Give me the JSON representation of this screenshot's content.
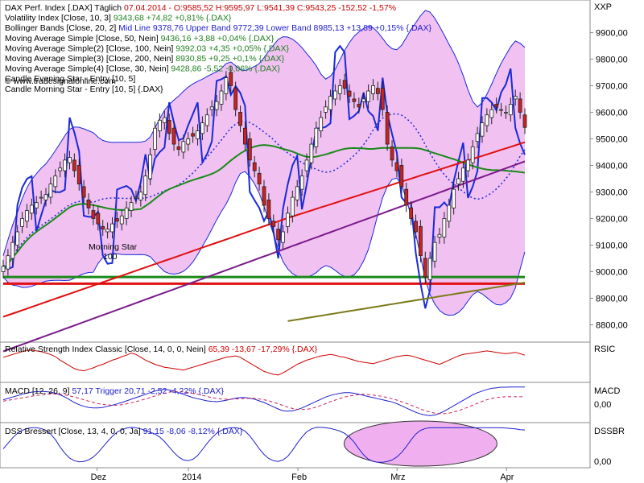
{
  "colors": {
    "candle_up": "#ffffff",
    "candle_down": "#cc2222",
    "bollinger_fill": "#eeb6ee",
    "bollinger_band": "#1a2ad8",
    "sma50": "#1a8a1a",
    "sma100": "#e01010",
    "sma200": "#7a1a8a",
    "sma30": "#7a7a1a",
    "rsi": "#cc0000",
    "macd": "#2020cc",
    "macd_trigger": "#cc2255",
    "dss": "#2020cc",
    "highlight": "#f0b0f0"
  },
  "chart_data": [
    {
      "type": "candlestick",
      "panel": "price",
      "title": "DAX Perf. Index [.DAX] Täglich",
      "legend": [
        {
          "label": "DAX Perf. Index [.DAX] Täglich",
          "values": "07.04.2014 - O:9585,52 H:9595,97 L:9541,39 C:9543,25 -152,52 -1,57%"
        },
        {
          "label": "Volatility Index [Close, 10, 3]",
          "values": "9343,68 +74,82 +0,81% {.DAX}"
        },
        {
          "label": "Bollinger Bands [Close, 20, 2]",
          "values": "Mid Line 9378,76 Upper Band 9772,39 Lower Band 8985,13 +13,89 +0,15% {.DAX}"
        },
        {
          "label": "Moving Average Simple [Close, 50, Nein]",
          "values": "9436,16 +3,88 +0,04% {.DAX}"
        },
        {
          "label": "Moving Average Simple(2) [Close, 100, Nein]",
          "values": "9392,03 +4,35 +0,05% {.DAX}"
        },
        {
          "label": "Moving Average Simple(3) [Close, 200, Nein]",
          "values": "8930,85 +9,25 +0,1% {.DAX}"
        },
        {
          "label": "Moving Average Simple(4) [Close, 30, Nein]",
          "values": "9428,86 -5,52 -0,06% {.DAX}"
        },
        {
          "label": "Candle Evening Star - Entry [10, 5]",
          "values": ""
        },
        {
          "label": "Candle Morning Star - Entry [10, 5] {.DAX}",
          "values": ""
        }
      ],
      "watermark": "© www.tradesignalonline.com",
      "annotations": [
        "Morning Star",
        "100"
      ],
      "y_ticks": [
        "8800,00",
        "8900,00",
        "9000,00",
        "9100,00",
        "9200,00",
        "9300,00",
        "9400,00",
        "9500,00",
        "9600,00",
        "9700,00",
        "9800,00",
        "9900,00"
      ],
      "y_axis_label": "XXP",
      "ylim": [
        8750,
        9980
      ],
      "horizontal_lines": [
        {
          "value": 8980,
          "color": "#1a8a1a"
        },
        {
          "value": 8955,
          "color": "#e01010"
        }
      ],
      "closes": [
        9020,
        9060,
        9110,
        9150,
        9200,
        9230,
        9250,
        9260,
        9280,
        9290,
        9330,
        9360,
        9390,
        9420,
        9430,
        9380,
        9330,
        9280,
        9240,
        9200,
        9180,
        9160,
        9160,
        9180,
        9190,
        9210,
        9240,
        9260,
        9280,
        9300,
        9360,
        9440,
        9540,
        9570,
        9580,
        9520,
        9480,
        9460,
        9490,
        9500,
        9510,
        9530,
        9560,
        9590,
        9620,
        9640,
        9680,
        9730,
        9700,
        9610,
        9550,
        9480,
        9420,
        9380,
        9330,
        9250,
        9200,
        9170,
        9120,
        9150,
        9220,
        9280,
        9320,
        9360,
        9420,
        9480,
        9540,
        9580,
        9620,
        9660,
        9680,
        9700,
        9690,
        9660,
        9640,
        9620,
        9650,
        9680,
        9700,
        9670,
        9610,
        9480,
        9420,
        9380,
        9320,
        9250,
        9200,
        9150,
        9060,
        8980,
        9050,
        9110,
        9140,
        9200,
        9250,
        9310,
        9350,
        9390,
        9420,
        9470,
        9520,
        9560,
        9590,
        9610,
        9620,
        9610,
        9600,
        9630,
        9660,
        9600,
        9543
      ],
      "macd_lines": {
        "ylim": [
          -65,
          65
        ],
        "y_ticks": [
          "0,00"
        ],
        "label": "MACD"
      },
      "rsi_label": "RSIC",
      "dss_label": "DSSBR",
      "x_labels": [
        "Dez",
        "2014",
        "Feb",
        "Mrz",
        "Apr"
      ]
    },
    {
      "type": "line",
      "panel": "rsi",
      "title": "Relative Strength Index Classic [Close, 14, 0, 0, Nein]",
      "values_text": "65,39 -13,67 -17,29% {.DAX}",
      "y_label": "RSIC",
      "series": [
        {
          "values": [
            62,
            64,
            66,
            68,
            70,
            72,
            72,
            71,
            70,
            68,
            66,
            63,
            58,
            54,
            50,
            46,
            44,
            43,
            45,
            47,
            50,
            52,
            55,
            58,
            60,
            63,
            65,
            68,
            66,
            62,
            58,
            55,
            52,
            50,
            48,
            47,
            46,
            45,
            44,
            46,
            48,
            50,
            52,
            54,
            56,
            58,
            60,
            62,
            63,
            64,
            62,
            58,
            54,
            50,
            46,
            42,
            40,
            38,
            37,
            40,
            44,
            48,
            52,
            55,
            58,
            60,
            62,
            64,
            65,
            66,
            65,
            63,
            62,
            60,
            58,
            56,
            55,
            54,
            53,
            55,
            57,
            59,
            61,
            63,
            64,
            65,
            64,
            62,
            60,
            58,
            56,
            54,
            52,
            55,
            58,
            61,
            64,
            66,
            67,
            68,
            69,
            70,
            71,
            70,
            69,
            68,
            67,
            68,
            69,
            67,
            65
          ]
        }
      ]
    },
    {
      "type": "line",
      "panel": "macd",
      "title": "MACD [12, 26, 9]",
      "values_text": "57,17 Trigger 20,71 -2,52 -4,22% {.DAX}",
      "y_label": "MACD",
      "y_ticks": [
        "0,00"
      ],
      "series": [
        {
          "name": "MACD",
          "values": [
            10,
            15,
            20,
            25,
            30,
            35,
            38,
            40,
            41,
            40,
            38,
            34,
            28,
            20,
            10,
            0,
            -8,
            -14,
            -18,
            -20,
            -20,
            -18,
            -14,
            -10,
            -5,
            0,
            6,
            12,
            18,
            24,
            30,
            36,
            42,
            46,
            48,
            46,
            42,
            36,
            30,
            24,
            18,
            14,
            10,
            6,
            4,
            3,
            5,
            8,
            12,
            16,
            18,
            18,
            16,
            12,
            6,
            0,
            -8,
            -16,
            -24,
            -30,
            -32,
            -30,
            -26,
            -20,
            -12,
            -4,
            4,
            12,
            20,
            26,
            30,
            34,
            36,
            36,
            34,
            30,
            26,
            22,
            18,
            14,
            10,
            6,
            2,
            -4,
            -12,
            -20,
            -28,
            -36,
            -42,
            -46,
            -48,
            -46,
            -40,
            -32,
            -22,
            -12,
            -2,
            8,
            18,
            28,
            36,
            42,
            48,
            52,
            54,
            56,
            56,
            57,
            57,
            57,
            57
          ]
        },
        {
          "name": "Trigger",
          "values": [
            5,
            8,
            11,
            14,
            17,
            20,
            23,
            26,
            28,
            30,
            31,
            31,
            30,
            28,
            24,
            20,
            15,
            10,
            5,
            0,
            -4,
            -7,
            -9,
            -10,
            -10,
            -8,
            -5,
            -1,
            3,
            8,
            13,
            18,
            24,
            29,
            34,
            38,
            40,
            40,
            39,
            36,
            33,
            30,
            26,
            22,
            18,
            15,
            13,
            12,
            12,
            13,
            14,
            15,
            15,
            15,
            13,
            10,
            6,
            1,
            -5,
            -11,
            -17,
            -22,
            -25,
            -26,
            -25,
            -22,
            -17,
            -11,
            -4,
            3,
            9,
            15,
            20,
            24,
            27,
            29,
            30,
            29,
            27,
            25,
            22,
            18,
            14,
            9,
            3,
            -3,
            -10,
            -17,
            -24,
            -30,
            -35,
            -39,
            -41,
            -41,
            -39,
            -35,
            -30,
            -24,
            -17,
            -10,
            -3,
            4,
            10,
            15,
            18,
            20,
            21,
            21,
            21,
            21,
            21
          ]
        }
      ]
    },
    {
      "type": "line",
      "panel": "dss",
      "title": "DSS Bressert [Close, 13, 4, 0, 0, Ja]",
      "values_text": "91,15 -8,06 -8,12% {.DAX}",
      "y_label": "DSSBR",
      "y_ticks": [
        "0,00"
      ],
      "series": [
        {
          "values": [
            40,
            55,
            70,
            82,
            90,
            95,
            97,
            97,
            95,
            90,
            80,
            65,
            45,
            28,
            15,
            8,
            5,
            6,
            10,
            18,
            30,
            45,
            60,
            74,
            85,
            92,
            96,
            98,
            97,
            94,
            90,
            85,
            80,
            72,
            60,
            45,
            30,
            18,
            10,
            8,
            12,
            22,
            38,
            55,
            70,
            82,
            90,
            95,
            97,
            97,
            95,
            88,
            75,
            58,
            40,
            25,
            14,
            8,
            6,
            10,
            20,
            36,
            55,
            72,
            86,
            94,
            98,
            98,
            97,
            95,
            92,
            88,
            82,
            72,
            58,
            40,
            24,
            12,
            6,
            4,
            4,
            6,
            10,
            18,
            30,
            46,
            64,
            80,
            90,
            95,
            97,
            97,
            97,
            97,
            97,
            97,
            97,
            97,
            97,
            97,
            97,
            97,
            97,
            97,
            97,
            97,
            96,
            95,
            94,
            92,
            91
          ]
        }
      ]
    }
  ]
}
